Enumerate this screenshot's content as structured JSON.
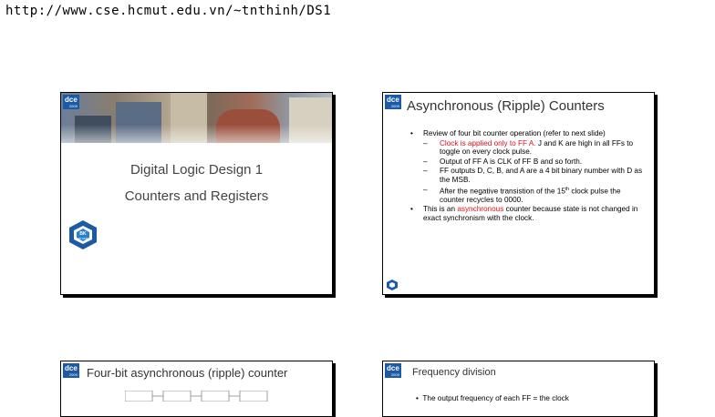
{
  "header": {
    "url": "http://www.cse.hcmut.edu.vn/~tnthinh/DS1"
  },
  "brand": {
    "logo_text": "dce",
    "logo_sub": "2009",
    "logo_color": "#1c5aa6",
    "emblem_text": "BK",
    "emblem_sub": "TP.HCM"
  },
  "slide1": {
    "title_line1": "Digital Logic Design 1",
    "title_line2": "Counters and Registers"
  },
  "slide2": {
    "title": "Asynchronous (Ripple) Counters",
    "bullets": [
      {
        "level": 1,
        "text": "Review of four bit counter operation (refer to next slide)"
      },
      {
        "level": 2,
        "red": "Clock is applied only to FF A.",
        "text": "  J and K are high in all FFs to toggle on every clock pulse."
      },
      {
        "level": 2,
        "text": "Output of FF A is CLK of FF B and so forth."
      },
      {
        "level": 2,
        "text": "FF outputs D, C, B, and A are a 4 bit binary number with D as the MSB."
      },
      {
        "level": 2,
        "text_before": "After the negative transistion of the 15",
        "sup": "th",
        "text_after": " clock pulse the counter recycles to 0000."
      },
      {
        "level": 1,
        "text_before": "This is an ",
        "red": "asynchronous",
        "text_after": " counter because state is not changed in exact synchronism with the clock."
      }
    ]
  },
  "slide3": {
    "title": "Four-bit asynchronous (ripple) counter"
  },
  "slide4": {
    "title": "Frequency division",
    "body": "The output frequency of each FF = the clock"
  }
}
